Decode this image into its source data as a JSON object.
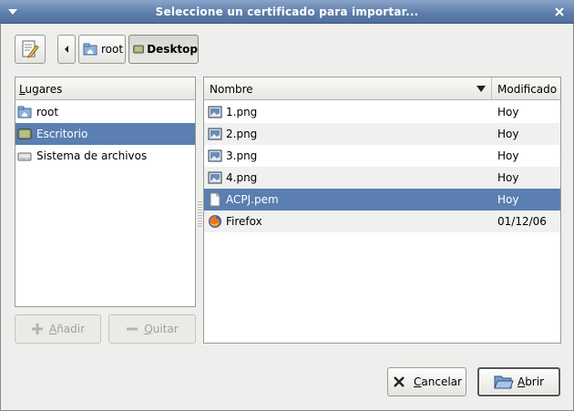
{
  "window": {
    "title": "Seleccione un certificado para importar...",
    "close_glyph": "✕",
    "menu_glyph": "▾"
  },
  "path_bar": {
    "back_glyph": "◂",
    "segments": [
      {
        "label": "root",
        "icon": "home-folder-icon"
      },
      {
        "label": "Desktop",
        "icon": "desktop-folder-icon",
        "active": true
      }
    ]
  },
  "places": {
    "header": "Lugares",
    "items": [
      {
        "label": "root",
        "icon": "home-folder-icon"
      },
      {
        "label": "Escritorio",
        "icon": "desktop-folder-icon",
        "selected": true
      },
      {
        "label": "Sistema de archivos",
        "icon": "drive-icon"
      }
    ],
    "add_label": "Añadir",
    "remove_label": "Quitar"
  },
  "files": {
    "col_name": "Nombre",
    "col_modified": "Modificado",
    "sort_glyph": "▼",
    "rows": [
      {
        "name": "1.png",
        "modified": "Hoy",
        "icon": "image-file-icon"
      },
      {
        "name": "2.png",
        "modified": "Hoy",
        "icon": "image-file-icon"
      },
      {
        "name": "3.png",
        "modified": "Hoy",
        "icon": "image-file-icon"
      },
      {
        "name": "4.png",
        "modified": "Hoy",
        "icon": "image-file-icon"
      },
      {
        "name": "ACPJ.pem",
        "modified": "Hoy",
        "icon": "document-file-icon",
        "selected": true
      },
      {
        "name": "Firefox",
        "modified": "01/12/06",
        "icon": "firefox-icon"
      }
    ]
  },
  "actions": {
    "cancel_label": "Cancelar",
    "open_label": "Abrir"
  },
  "colors": {
    "selection": "#5a7fb0",
    "titlebar": "#5f7fac"
  }
}
